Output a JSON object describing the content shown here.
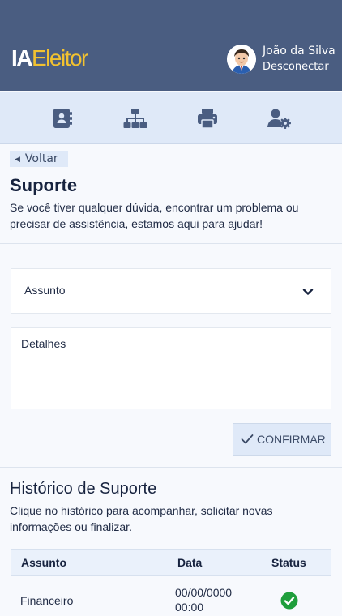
{
  "header": {
    "logo_ia": "IA",
    "logo_rest": "Eleitor",
    "user_name": "João da Silva",
    "logout_label": "Desconectar"
  },
  "nav": {
    "icons": [
      "contacts-book-icon",
      "sitemap-icon",
      "printer-icon",
      "user-settings-icon"
    ]
  },
  "support": {
    "back_label": "Voltar",
    "title": "Suporte",
    "description": "Se você tiver qualquer dúvida, encontrar um problema ou precisar de assistência, estamos aqui para ajudar!",
    "subject_value": "Assunto",
    "details_placeholder": "Detalhes",
    "confirm_label": "CONFIRMAR"
  },
  "history": {
    "title": "Histórico de Suporte",
    "description": "Clique no histórico para acompanhar, solicitar novas informações ou finalizar.",
    "columns": [
      "Assunto",
      "Data",
      "Status"
    ],
    "rows": [
      {
        "subject": "Financeiro",
        "date": "00/00/0000",
        "time": "00:00",
        "status": "resolved"
      }
    ]
  },
  "colors": {
    "header_bg": "#4a5d81",
    "logo_accent": "#f2c230",
    "nav_bg": "#dfe9f8",
    "status_ok": "#1f9e3c"
  }
}
